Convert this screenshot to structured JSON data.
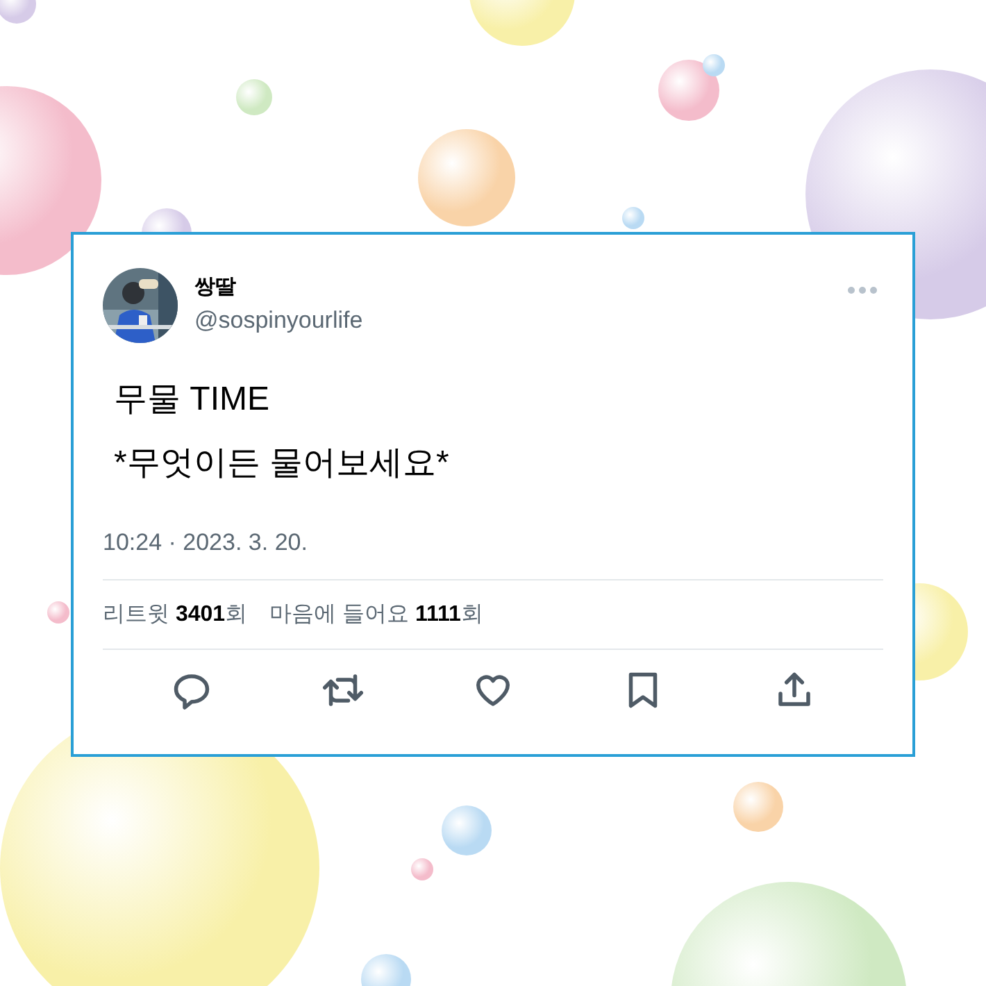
{
  "tweet": {
    "display_name": "쌍딸",
    "handle": "@sospinyourlife",
    "text_lines": [
      "무물 TIME",
      "*무엇이든 물어보세요*"
    ],
    "timestamp": "10:24 · 2023. 3. 20.",
    "stats": [
      "리트윗 **3401**회",
      "마음에 들어요 **1111**회"
    ],
    "actions": [
      {
        "kind": "reply"
      },
      {
        "kind": "retweet"
      },
      {
        "kind": "like"
      },
      {
        "kind": "bookmark"
      },
      {
        "kind": "share"
      }
    ]
  }
}
